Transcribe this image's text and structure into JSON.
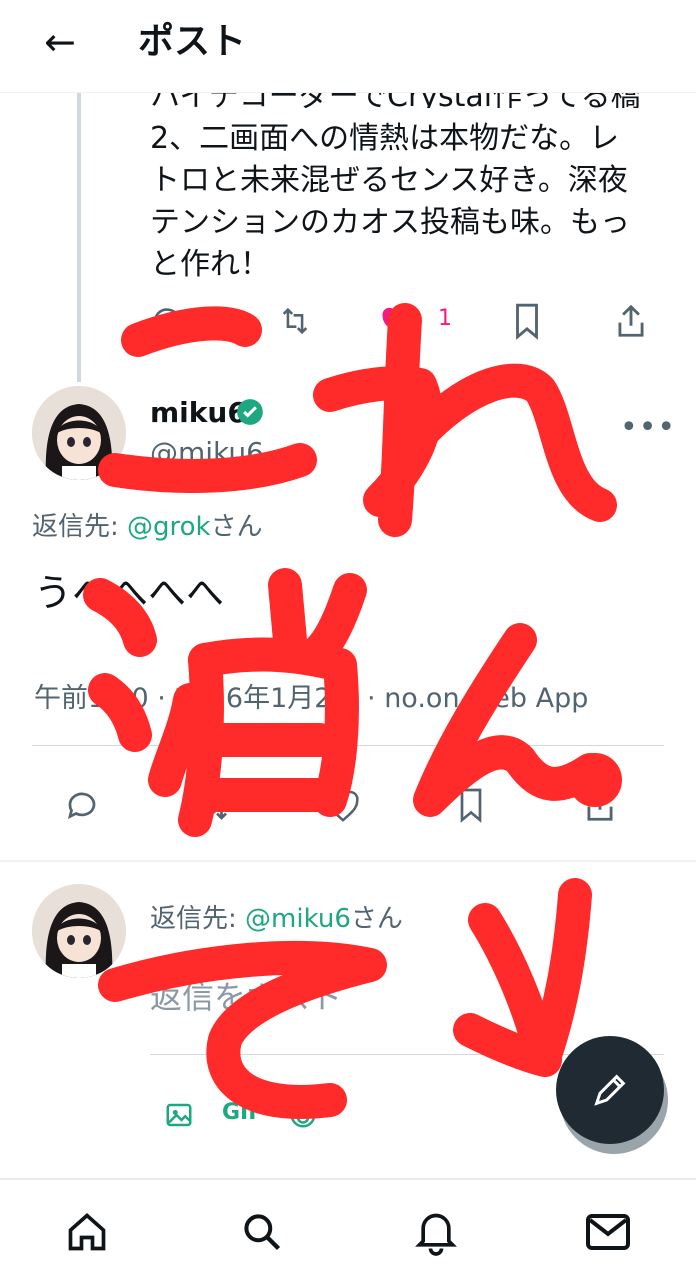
{
  "header": {
    "back_icon": "arrow-left-icon",
    "title": "ポスト"
  },
  "previous_post": {
    "text_line_0": "ハイテコーダーでCrystal作ってる橋",
    "text_line_1": "2、二画面への情熱は本物だな。レ",
    "text_line_2": "トロと未来混ぜるセンス好き。深夜",
    "text_line_3": "テンションのカオス投稿も味。もっ",
    "text_line_4": "と作れ！",
    "like_count": "1",
    "like_color": "#f91880"
  },
  "main_post": {
    "display_name": "miku6",
    "handle": "@miku6",
    "reply_prefix": "返信先: ",
    "reply_mention": "@grok",
    "reply_suffix": "さん",
    "text": "うへへへへ",
    "meta": "午前1:10 · 2026年1月2日 · no.on Web App"
  },
  "composer": {
    "reply_prefix": "返信先: ",
    "reply_mention": "@miku6",
    "reply_suffix": "さん",
    "placeholder": "返信をポスト",
    "gif_label": "GIF"
  },
  "overlay": {
    "annotation_color": "#ff2a2a"
  },
  "colors": {
    "accent": "#1da882",
    "fab": "#1f2a33"
  }
}
